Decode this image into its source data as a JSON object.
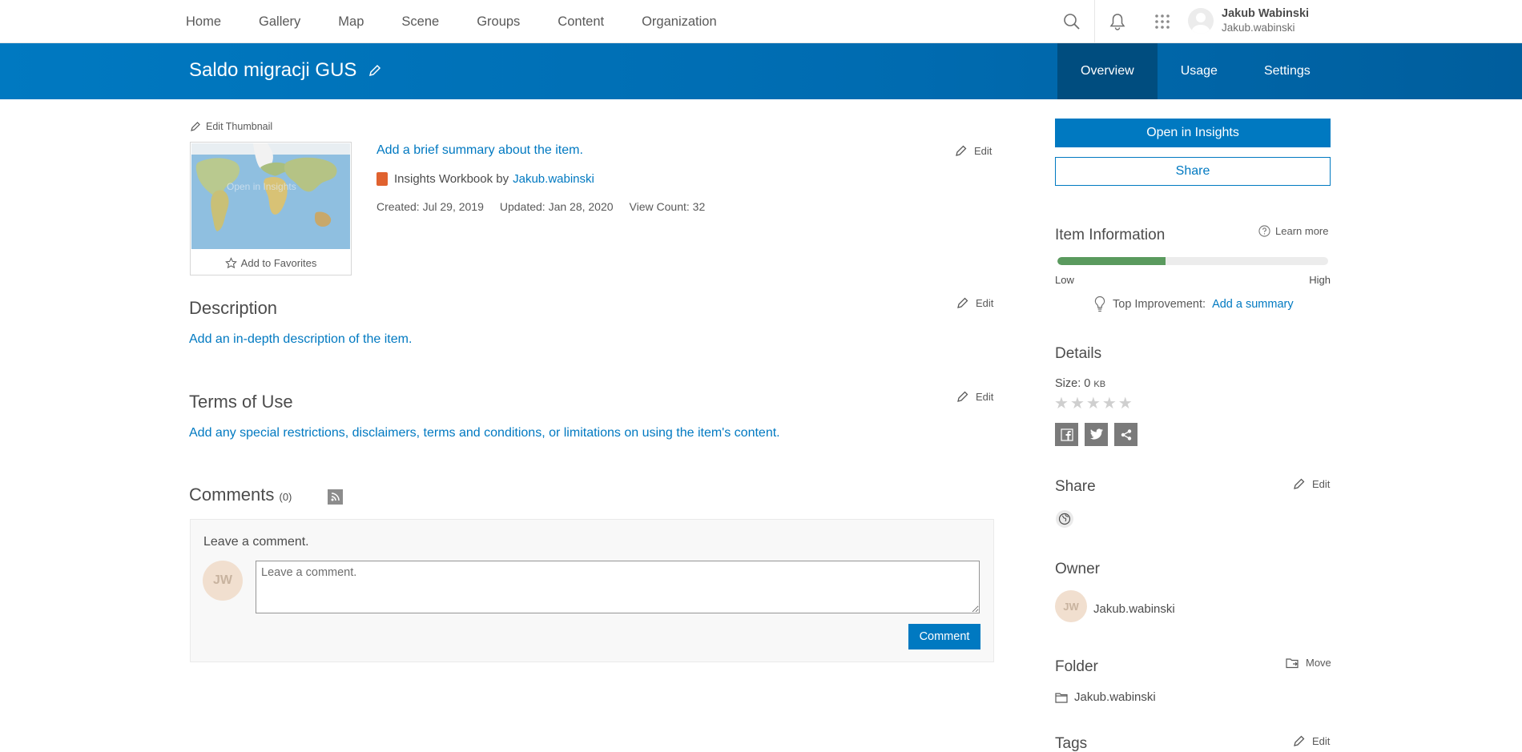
{
  "nav": {
    "items": [
      "Home",
      "Gallery",
      "Map",
      "Scene",
      "Groups",
      "Content",
      "Organization"
    ],
    "user_fullname": "Jakub Wabinski",
    "user_username": "Jakub.wabinski"
  },
  "header": {
    "title": "Saldo migracji GUS",
    "tabs": [
      "Overview",
      "Usage",
      "Settings"
    ],
    "active_tab": "Overview"
  },
  "item": {
    "edit_thumbnail": "Edit Thumbnail",
    "thumbnail_overlay": "Open in Insights",
    "add_to_favorites": "Add to Favorites",
    "summary_prompt": "Add a brief summary about the item.",
    "type_label": "Insights Workbook by",
    "owner_link": "Jakub.wabinski",
    "created": "Created: Jul 29, 2019",
    "updated": "Updated: Jan 28, 2020",
    "view_count": "View Count: 32",
    "edit_label": "Edit"
  },
  "description": {
    "heading": "Description",
    "prompt": "Add an in-depth description of the item."
  },
  "terms": {
    "heading": "Terms of Use",
    "prompt": "Add any special restrictions, disclaimers, terms and conditions, or limitations on using the item's content."
  },
  "comments": {
    "heading": "Comments",
    "count": "(0)",
    "leave_label": "Leave a comment.",
    "placeholder": "Leave a comment.",
    "avatar_initials": "JW",
    "submit": "Comment"
  },
  "sidebar": {
    "open_button": "Open in Insights",
    "share_button": "Share",
    "item_info_heading": "Item Information",
    "learn_more": "Learn more",
    "quality_fraction": 0.4,
    "low": "Low",
    "high": "High",
    "top_improvement_label": "Top Improvement:",
    "top_improvement_link": "Add a summary",
    "details_heading": "Details",
    "size_label": "Size: 0",
    "size_unit": "KB",
    "rating_stars": 5,
    "share_heading": "Share",
    "share_edit": "Edit",
    "owner_heading": "Owner",
    "owner_initials": "JW",
    "owner_name": "Jakub.wabinski",
    "folder_heading": "Folder",
    "move_label": "Move",
    "folder_name": "Jakub.wabinski",
    "tags_heading": "Tags",
    "tags_edit": "Edit"
  },
  "colors": {
    "accent": "#0079c1",
    "banner_active_tab": "#004d7f",
    "quality_fill": "#5a9a5e"
  }
}
